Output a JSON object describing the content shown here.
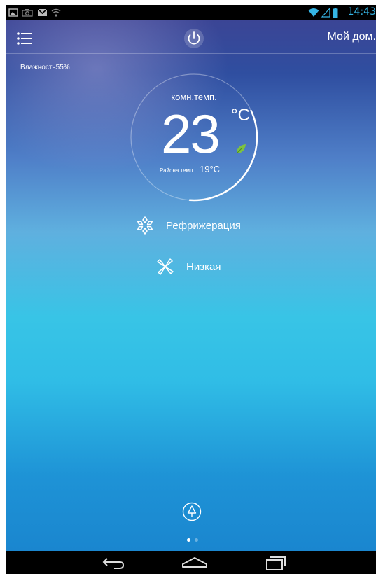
{
  "status_bar": {
    "time": "14:43",
    "left_icons": [
      "picture-notification-icon",
      "camera-notification-icon",
      "gmail-notification-icon",
      "wifi-notification-icon"
    ],
    "right_icons": [
      "wifi-signal-icon",
      "cell-signal-icon",
      "battery-icon"
    ]
  },
  "header": {
    "title": "Мой дом.",
    "menu_icon": "list-menu-icon",
    "power_icon": "power-icon"
  },
  "humidity": "Влажность55%",
  "dial": {
    "room_temp_label": "комн.темп.",
    "temperature": "23",
    "unit": "°C",
    "outdoor_label": "Района темп",
    "outdoor_value": "19°C",
    "eco_icon": "leaf-icon",
    "arc_fraction": 0.33
  },
  "modes": {
    "mode_label": "Рефрижерация",
    "mode_icon": "snowflake-icon",
    "fan_label": "Низкая",
    "fan_icon": "fan-icon"
  },
  "bottom": {
    "clean_icon": "tree-icon",
    "pages": 2,
    "active_page": 0
  },
  "nav": {
    "back_icon": "back-icon",
    "home_icon": "home-icon",
    "recents_icon": "recents-icon"
  },
  "colors": {
    "accent": "#35b5e5",
    "leaf": "#7cc242",
    "gradient_top": "#3b4595",
    "gradient_mid": "#38c4e6",
    "gradient_bottom": "#1a86cf"
  }
}
